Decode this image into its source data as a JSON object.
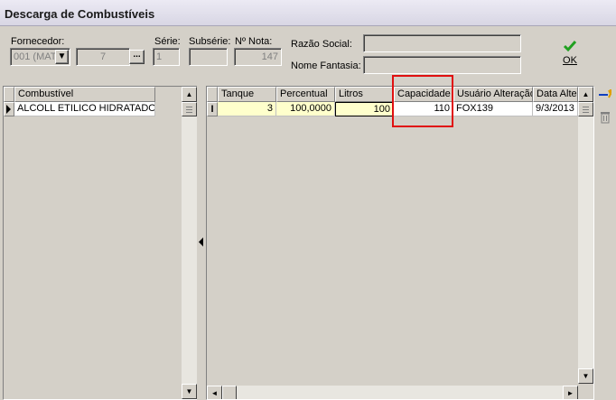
{
  "window": {
    "title": "Descarga de Combustíveis"
  },
  "header": {
    "fornecedor_label": "Fornecedor:",
    "fornecedor_value": "001 (MAT",
    "fornecedor_num": "7",
    "ellipsis": "...",
    "serie_label": "Série:",
    "serie_value": "1",
    "subserie_label": "Subsérie:",
    "subserie_value": "",
    "nota_label": "Nº Nota:",
    "nota_value": "147",
    "razao_label": "Razão Social:",
    "razao_value": "",
    "fantasia_label": "Nome Fantasia:",
    "fantasia_value": "",
    "ok_label": "OK"
  },
  "left_grid": {
    "header": "Combustível",
    "rows": [
      {
        "combustivel": "ALCOLL ETILICO HIDRATADO"
      }
    ]
  },
  "right_grid": {
    "columns": [
      "Tanque",
      "Percentual",
      "Litros",
      "Capacidade",
      "Usuário Alteração",
      "Data Alter"
    ],
    "rows": [
      {
        "tanque": "3",
        "percentual": "100,0000",
        "litros": "100",
        "capacidade": "110",
        "usuario": "FOX139",
        "data": "9/3/2013"
      }
    ]
  },
  "icons": {
    "ok": "green-check-icon",
    "add": "add-row-icon",
    "delete": "trash-icon",
    "splitter": "collapse-left-icon"
  },
  "colors": {
    "edit_row": "#ffffcc",
    "highlight": "#e01010",
    "ok_check": "#20a020"
  }
}
